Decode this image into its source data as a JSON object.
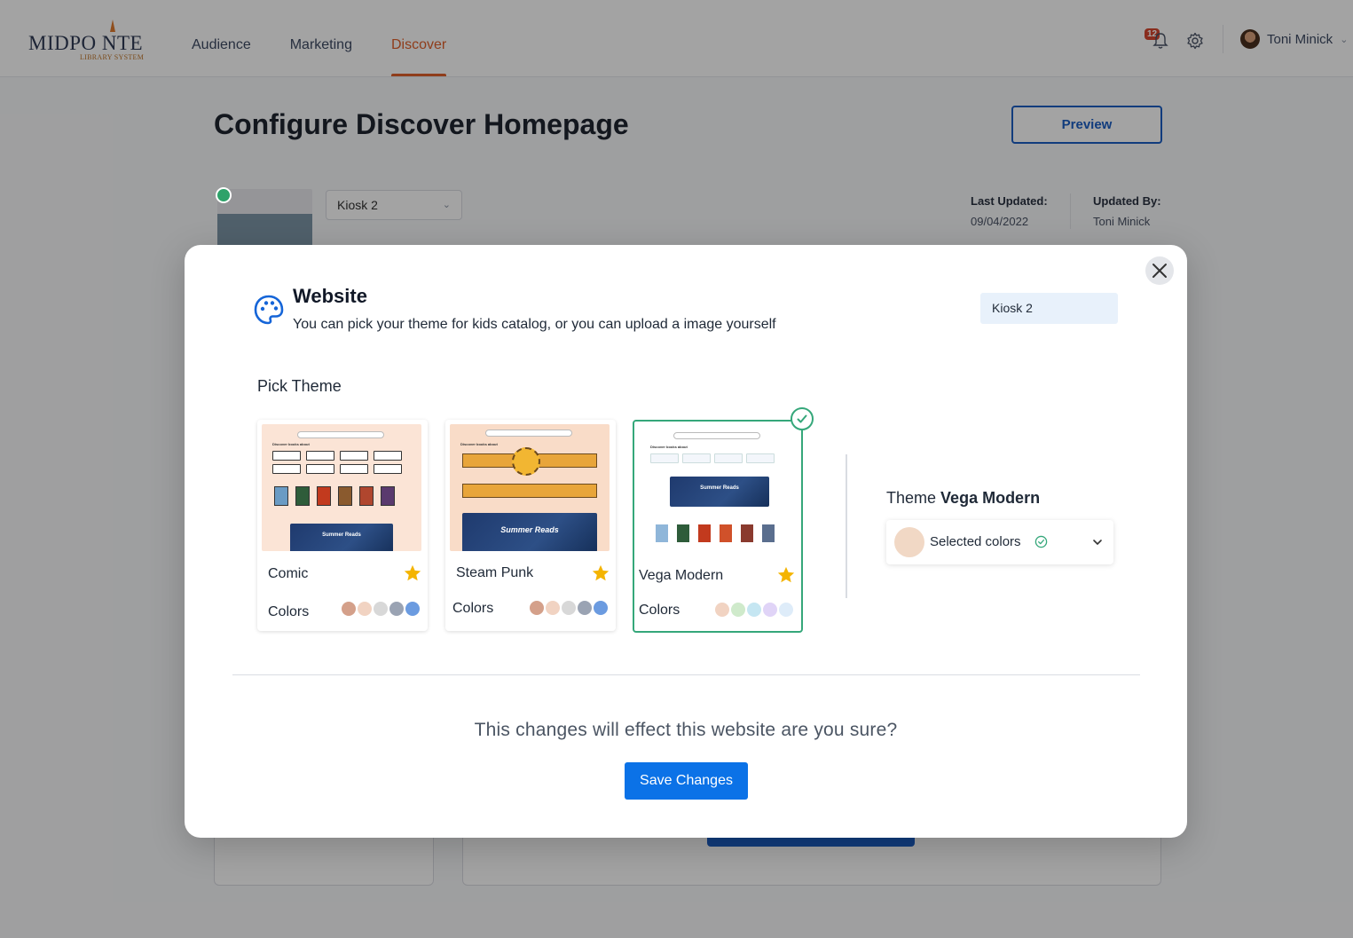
{
  "header": {
    "logo_main": "MIDPO NTE",
    "logo_sub": "LIBRARY SYSTEM",
    "nav": [
      {
        "label": "Audience"
      },
      {
        "label": "Marketing"
      },
      {
        "label": "Discover"
      }
    ],
    "active_nav": "Discover",
    "notification_count": "12",
    "user_name": "Toni Minick"
  },
  "page": {
    "title": "Configure Discover Homepage",
    "preview_label": "Preview",
    "kiosk_select": "Kiosk 2",
    "last_updated_label": "Last Updated:",
    "last_updated_value": "09/04/2022",
    "updated_by_label": "Updated By:",
    "updated_by_value": "Toni Minick"
  },
  "modal": {
    "title": "Website",
    "subtitle": "You can pick your theme for kids catalog, or you can upload a image yourself",
    "kiosk_value": "Kiosk 2",
    "pick_label": "Pick Theme",
    "themes": [
      {
        "name": "Comic",
        "colors_label": "Colors",
        "swatches": [
          "#d4a08a",
          "#f1d3c2",
          "#d8d8d8",
          "#9aa3b3",
          "#6b9be0"
        ],
        "thumb_banner": "Summer Reads"
      },
      {
        "name": "Steam Punk",
        "colors_label": "Colors",
        "swatches": [
          "#d4a08a",
          "#f1d3c2",
          "#d8d8d8",
          "#9aa3b3",
          "#6b9be0"
        ],
        "thumb_banner": "Summer Reads"
      },
      {
        "name": "Vega Modern",
        "colors_label": "Colors",
        "swatches": [
          "#f1d3c2",
          "#cfeacb",
          "#c5e6f2",
          "#e0d4f7",
          "#deecf9"
        ],
        "thumb_banner": "Summer Reads"
      }
    ],
    "selected_theme_prefix": "Theme",
    "selected_theme_name": "Vega Modern",
    "selected_colors_label": "Selected colors",
    "confirm_text": "This changes will effect this website are you sure?",
    "save_label": "Save Changes"
  },
  "colors": {
    "accent_orange": "#e0602b",
    "primary_blue": "#0b72e7",
    "selected_green": "#35a77a",
    "star": "#f4b400"
  }
}
